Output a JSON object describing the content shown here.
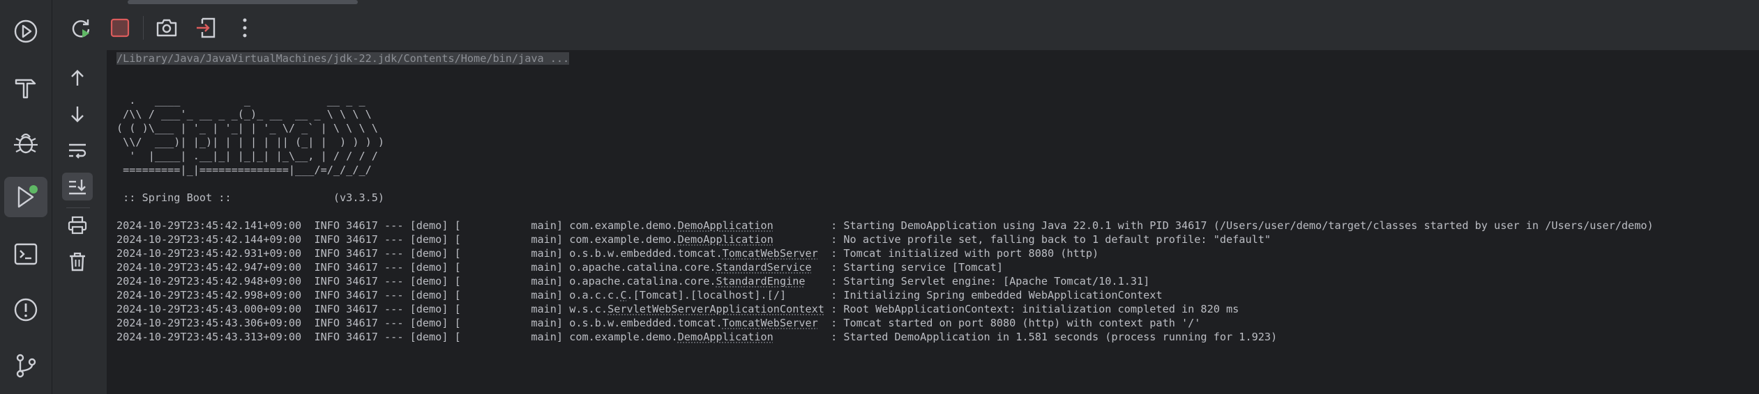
{
  "sidebar": {
    "items": [
      {
        "icon": "run-debug-widget-icon"
      },
      {
        "icon": "build-hammer-icon"
      },
      {
        "icon": "debug-bug-icon"
      },
      {
        "icon": "run-play-icon",
        "active": true,
        "status_color": "#5fb865"
      },
      {
        "icon": "terminal-icon"
      },
      {
        "icon": "problems-icon"
      },
      {
        "icon": "git-icon"
      }
    ]
  },
  "toolbar": {
    "buttons": [
      "rerun-icon",
      "stop-icon",
      "screenshot-icon",
      "exit-icon",
      "more-vertical-icon"
    ],
    "stop_color": "#db5c5c",
    "rerun_badge_color": "#5fb865"
  },
  "left_tools": [
    "arrow-up-icon",
    "arrow-down-icon",
    "soft-wrap-icon",
    "scroll-to-end-icon",
    "print-icon",
    "trash-icon"
  ],
  "console": {
    "command": "/Library/Java/JavaVirtualMachines/jdk-22.jdk/Contents/Home/bin/java ...",
    "banner": [
      "  .   ____          _            __ _ _",
      " /\\\\ / ___'_ __ _ _(_)_ __  __ _ \\ \\ \\ \\",
      "( ( )\\___ | '_ | '_| | '_ \\/ _` | \\ \\ \\ \\",
      " \\\\/  ___)| |_)| | | | | || (_| |  ) ) ) )",
      "  '  |____| .__|_| |_|_| |_\\__, | / / / /",
      " =========|_|==============|___/=/_/_/_/"
    ],
    "spring_boot_label": " :: Spring Boot ::                (v3.3.5)",
    "logs": [
      {
        "prefix": "2024-10-29T23:45:42.141+09:00  INFO 34617 --- [demo] [           main] com.example.demo.",
        "cls": "DemoApplication",
        "suffix": "         : Starting DemoApplication using Java 22.0.1 with PID 34617 (/Users/user/demo/target/classes started by user in /Users/user/demo)"
      },
      {
        "prefix": "2024-10-29T23:45:42.144+09:00  INFO 34617 --- [demo] [           main] com.example.demo.",
        "cls": "DemoApplication",
        "suffix": "         : No active profile set, falling back to 1 default profile: \"default\""
      },
      {
        "prefix": "2024-10-29T23:45:42.931+09:00  INFO 34617 --- [demo] [           main] o.s.b.w.embedded.tomcat.",
        "cls": "TomcatWebServer",
        "suffix": "  : Tomcat initialized with port 8080 (http)"
      },
      {
        "prefix": "2024-10-29T23:45:42.947+09:00  INFO 34617 --- [demo] [           main] o.apache.catalina.core.",
        "cls": "StandardService",
        "suffix": "   : Starting service [Tomcat]"
      },
      {
        "prefix": "2024-10-29T23:45:42.948+09:00  INFO 34617 --- [demo] [           main] o.apache.catalina.core.",
        "cls": "StandardEngine",
        "suffix": "    : Starting Servlet engine: [Apache Tomcat/10.1.31]"
      },
      {
        "prefix": "2024-10-29T23:45:42.998+09:00  INFO 34617 --- [demo] [           main] o.a.c.c.",
        "cls": "C",
        "suffix": ".[Tomcat].[localhost].[/]       : Initializing Spring embedded WebApplicationContext"
      },
      {
        "prefix": "2024-10-29T23:45:43.000+09:00  INFO 34617 --- [demo] [           main] w.s.c.",
        "cls": "ServletWebServerApplicationContext",
        "suffix": " : Root WebApplicationContext: initialization completed in 820 ms"
      },
      {
        "prefix": "2024-10-29T23:45:43.306+09:00  INFO 34617 --- [demo] [           main] o.s.b.w.embedded.tomcat.",
        "cls": "TomcatWebServer",
        "suffix": "  : Tomcat started on port 8080 (http) with context path '/'"
      },
      {
        "prefix": "2024-10-29T23:45:43.313+09:00  INFO 34617 --- [demo] [           main] com.example.demo.",
        "cls": "DemoApplication",
        "suffix": "         : Started DemoApplication in 1.581 seconds (process running for 1.923)"
      }
    ]
  }
}
